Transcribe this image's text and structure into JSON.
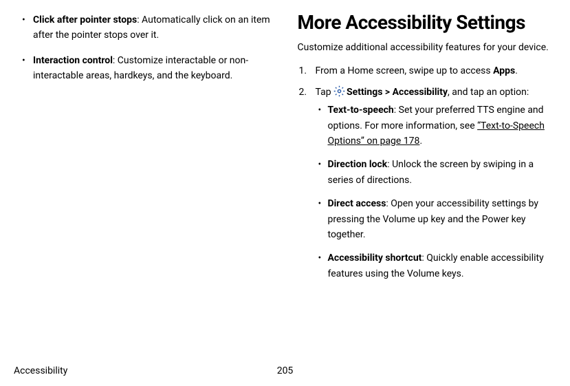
{
  "left": {
    "items": [
      {
        "title": "Click after pointer stops",
        "desc": ": Automatically click on an item after the pointer stops over it."
      },
      {
        "title": "Interaction control",
        "desc": ": Customize interactable or non-interactable areas, hardkeys, and the keyboard."
      }
    ]
  },
  "right": {
    "heading": "More Accessibility Settings",
    "intro": "Customize additional accessibility features for your device.",
    "steps": {
      "step1_prefix": "From a Home screen, swipe up to access ",
      "step1_bold": "Apps",
      "step1_suffix": ".",
      "step2_prefix": "Tap ",
      "step2_settings": "Settings",
      "step2_sep": " > ",
      "step2_accessibility": "Accessibility",
      "step2_suffix": ", and tap an option:"
    },
    "options": [
      {
        "title": "Text-to-speech",
        "desc_a": ": Set your preferred TTS engine and options. For more information, see ",
        "link": "“Text-to-Speech Options” on page 178",
        "desc_b": "."
      },
      {
        "title": "Direction lock",
        "desc_a": ": Unlock the screen by swiping in a series of directions.",
        "link": "",
        "desc_b": ""
      },
      {
        "title": "Direct access",
        "desc_a": ": Open your accessibility settings by pressing the Volume up key and the Power key together.",
        "link": "",
        "desc_b": ""
      },
      {
        "title": "Accessibility shortcut",
        "desc_a": ": Quickly enable accessibility features using the Volume keys.",
        "link": "",
        "desc_b": ""
      }
    ]
  },
  "footer": {
    "section": "Accessibility",
    "page": "205"
  }
}
